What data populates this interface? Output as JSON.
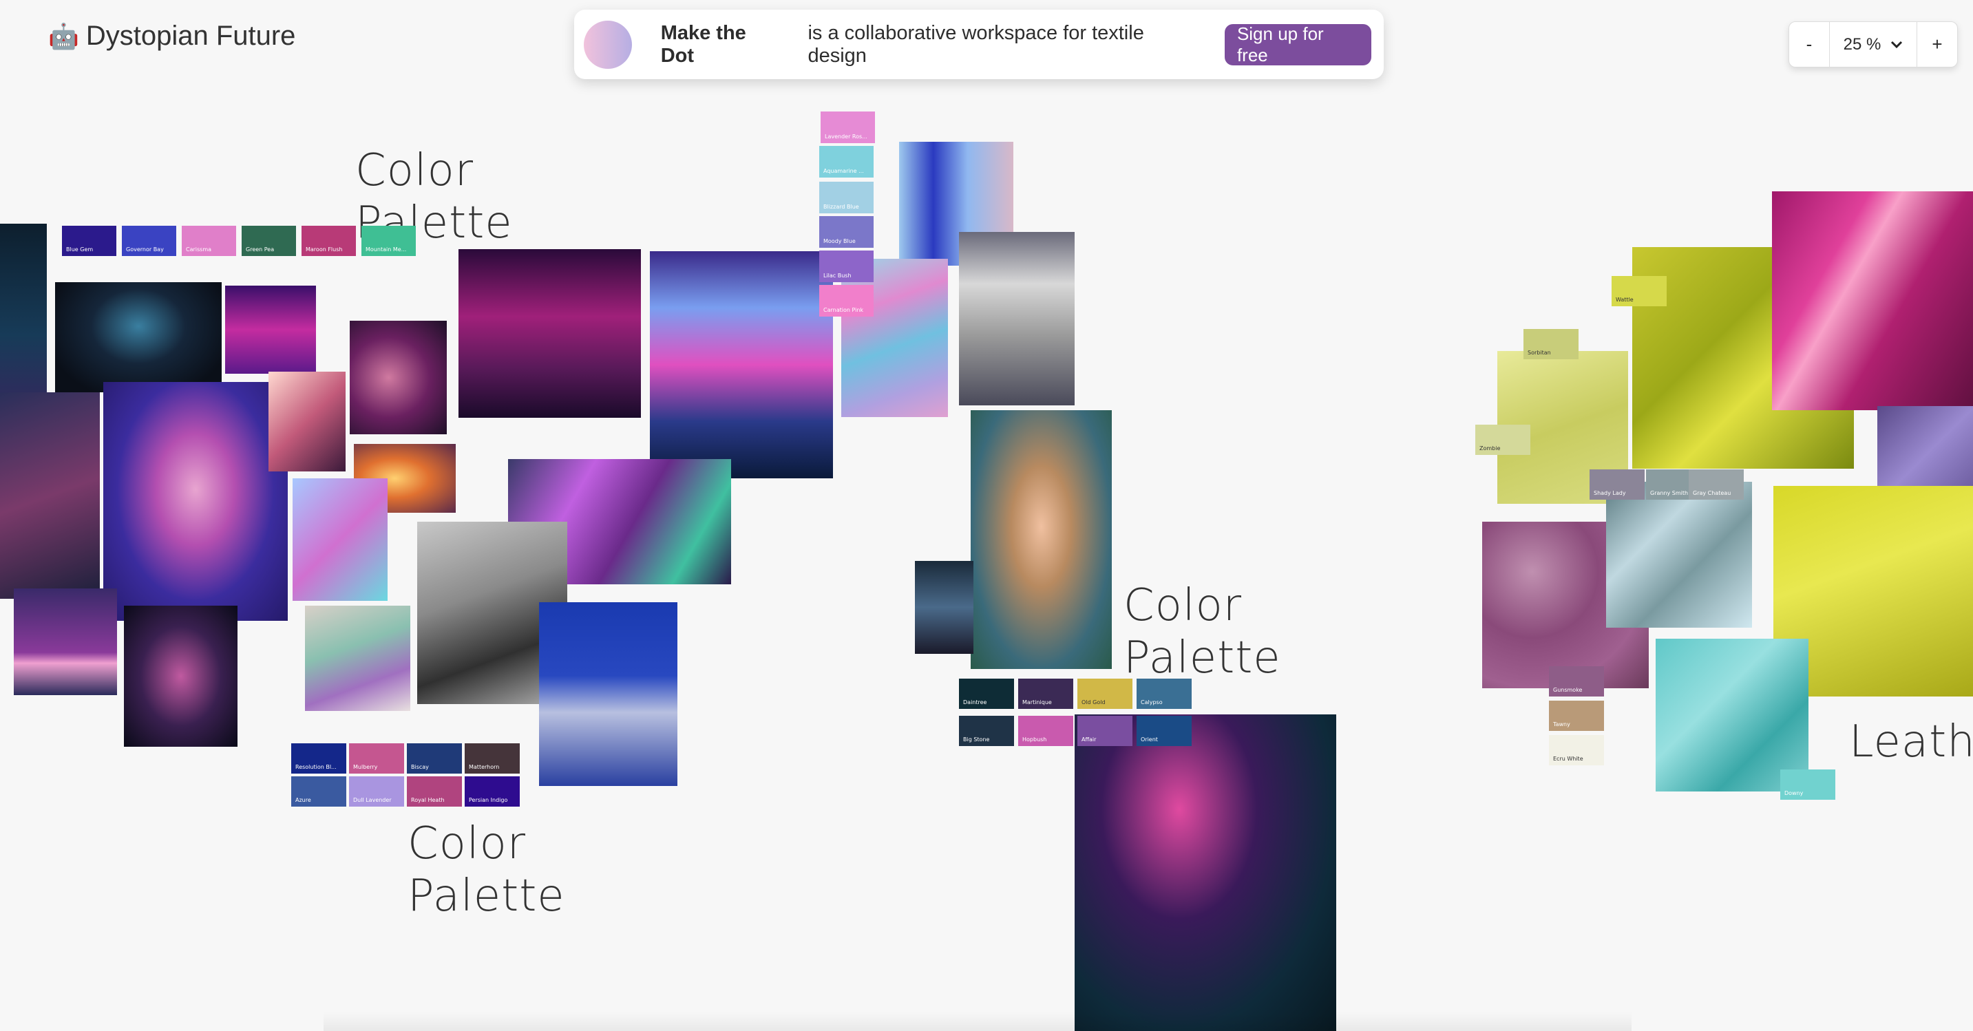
{
  "app": {
    "title": "Dystopian Future",
    "logo_icon": "robot-icon"
  },
  "banner": {
    "brand": "Make the Dot",
    "tagline": "is a collaborative workspace for textile design",
    "cta": "Sign up for free"
  },
  "zoom": {
    "minus": "-",
    "value": "25 %",
    "plus": "+"
  },
  "titles": {
    "palette1": "Color Palette",
    "palette2": "Color Palette",
    "palette3": "Color Palette",
    "leather": "Leathe"
  },
  "swatches": {
    "row_top": [
      "Blue Gem",
      "Governor Bay",
      "Carissma",
      "Green Pea",
      "Maroon Flush",
      "Mountain Me..."
    ],
    "column": [
      "Lavender Ros...",
      "Aquamarine ...",
      "Blizzard Blue",
      "Moody Blue",
      "Lilac Bush",
      "Carnation Pink"
    ],
    "grid_left": [
      "Resolution Bl...",
      "Mulberry",
      "Biscay",
      "Matterhorn",
      "Azure",
      "Dull Lavender",
      "Royal Heath",
      "Persian Indigo"
    ],
    "grid_mid": [
      "Daintree",
      "Martinique",
      "Old Gold",
      "Calypso",
      "Big Stone",
      "Hopbush",
      "Affair",
      "Orient"
    ],
    "textile": [
      "Wattle",
      "Sorbitan",
      "Zombie",
      "Shady Lady",
      "Granny Smith",
      "Gray Chateau",
      "Gunsmoke",
      "Tawny",
      "Ecru White",
      "Downy"
    ]
  },
  "colors": {
    "brand": "#7c4d9d",
    "row_top": [
      "#2b1a8c",
      "#3a43c2",
      "#e07fc9",
      "#2f6a52",
      "#b83a77",
      "#3fbf94"
    ],
    "column": [
      "#e68bd5",
      "#7fd1dd",
      "#a2d0e4",
      "#7b77c9",
      "#8d65c9",
      "#f17fcb"
    ],
    "grid_left": [
      "#14278a",
      "#c55690",
      "#1f3a78",
      "#45343a",
      "#3a5aa0",
      "#a995e0",
      "#b0447f",
      "#2e0c8f"
    ],
    "grid_mid": [
      "#0e2c36",
      "#3b2a55",
      "#d1b847",
      "#3a6f94",
      "#1f3347",
      "#c95aae",
      "#7a4ea0",
      "#1a4b86"
    ],
    "textile": [
      "#d6d94a",
      "#c8cd7a",
      "#d4d99a",
      "#8b8598",
      "#8a9ca0",
      "#9aa4a8",
      "#8e5d88",
      "#b99a78",
      "#f2f1e6",
      "#71d2cf"
    ]
  }
}
